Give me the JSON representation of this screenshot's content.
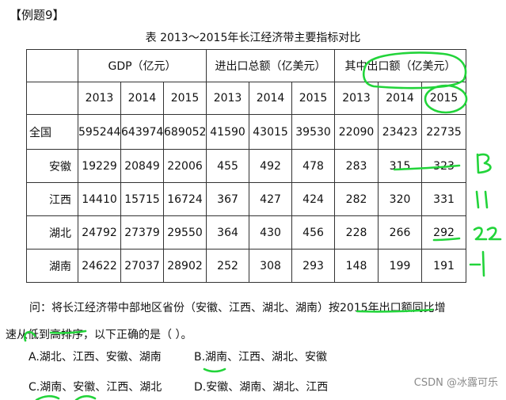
{
  "example_label": "【例题9】",
  "table": {
    "title": "表 2013～2015年长江经济带主要指标对比",
    "groups": [
      "GDP（亿元）",
      "进出口总额（亿美元）",
      "其中出口额（亿美元）"
    ],
    "years": [
      "2013",
      "2014",
      "2015"
    ],
    "rows": [
      {
        "name": "全国",
        "values": [
          "595244",
          "643974",
          "689052",
          "41590",
          "43015",
          "39530",
          "22090",
          "23423",
          "22735"
        ]
      },
      {
        "name": "安徽",
        "values": [
          "19229",
          "20849",
          "22006",
          "455",
          "492",
          "478",
          "283",
          "315",
          "323"
        ]
      },
      {
        "name": "江西",
        "values": [
          "14410",
          "15715",
          "16724",
          "367",
          "427",
          "424",
          "282",
          "320",
          "331"
        ]
      },
      {
        "name": "湖北",
        "values": [
          "24792",
          "27379",
          "29550",
          "364",
          "430",
          "456",
          "228",
          "266",
          "292"
        ]
      },
      {
        "name": "湖南",
        "values": [
          "24622",
          "27037",
          "28902",
          "252",
          "308",
          "293",
          "148",
          "199",
          "191"
        ]
      }
    ]
  },
  "question": {
    "line1": "问：将长江经济带中部地区省份（安徽、江西、湖北、湖南）按2015年出口额同比增",
    "line2": "速从低到高排序，以下正确的是（ ）。"
  },
  "options": {
    "a": "A.湖北、江西、安徽、湖南",
    "b": "B.湖南、江西、湖北、安徽",
    "c": "C.湖南、安徽、江西、湖北",
    "d": "D.安徽、湖南、湖北、江西"
  },
  "watermark": "CSDN @冰露可乐",
  "annotation_color": "#22d43a"
}
